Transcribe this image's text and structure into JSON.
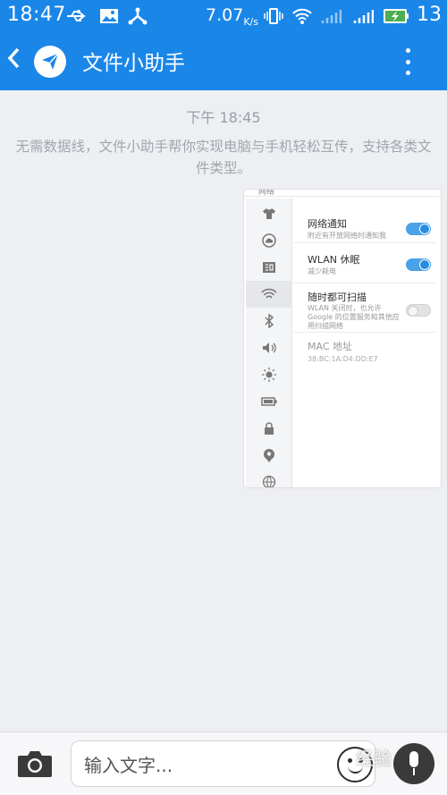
{
  "status": {
    "time": "18:47",
    "speed": "7.07",
    "speed_unit": "K/s",
    "battery_level": "13"
  },
  "appbar": {
    "title": "文件小助手"
  },
  "chat": {
    "timestamp": "下午 18:45",
    "notice": "无需数据线，文件小助手帮你实现电脑与手机轻松互传，支持各类文件类型。"
  },
  "image_message": {
    "header": "网络",
    "settings": [
      {
        "title": "网络通知",
        "subtitle": "附近有开放网络时通知我",
        "toggle": "on"
      },
      {
        "title": "WLAN 休眠",
        "subtitle": "减少耗电",
        "toggle": "on"
      },
      {
        "title": "随时都可扫描",
        "subtitle": "WLAN 关闭时，也允许 Google 的位置服务和其他应用扫描网络",
        "toggle": "off"
      },
      {
        "title": "MAC 地址",
        "subtitle": "38:BC:1A:D4:DD:E7"
      }
    ],
    "side_icons": [
      "tshirt-icon",
      "cloud-icon",
      "sim-icon",
      "wifi-icon",
      "bluetooth-icon",
      "volume-icon",
      "brightness-icon",
      "battery-icon",
      "lock-icon",
      "location-icon",
      "globe-icon"
    ]
  },
  "input": {
    "placeholder": "输入文字..."
  },
  "watermark": "经验",
  "colors": {
    "accent": "#1a86e8",
    "background": "#eeeff3",
    "toggle_on": "#4aa3e8"
  }
}
